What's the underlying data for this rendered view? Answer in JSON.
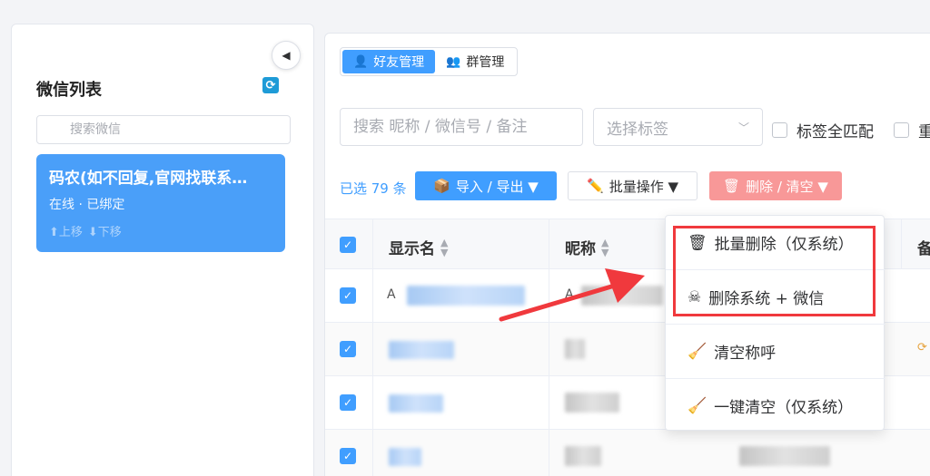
{
  "left_panel": {
    "collapse_icon": "◀",
    "title": "微信列表",
    "refresh_icon": "refresh-icon",
    "search_placeholder": "搜索微信",
    "account": {
      "name": "码农(如不回复,官网找联系…",
      "status": "在线 · 已绑定",
      "move_up": "⬆上移",
      "move_down": "⬇下移"
    }
  },
  "tabs": [
    {
      "label": "好友管理",
      "icon": "👤",
      "active": true
    },
    {
      "label": "群管理",
      "icon": "👥",
      "active": false
    }
  ],
  "filters": {
    "search_placeholder": "搜索 昵称 / 微信号 / 备注",
    "tag_placeholder": "选择标签",
    "tag_match_label": "标签全匹配",
    "second_check_label": "重"
  },
  "toolbar": {
    "selected_count": "已选 79 条",
    "import_export": "导入 / 导出 ▼",
    "import_icon": "📦",
    "batch_ops": "批量操作 ▼",
    "batch_icon": "✏️",
    "delete_clear": "删除 / 清空 ▼",
    "delete_icon": "🗑"
  },
  "table": {
    "headers": {
      "display_name": "显示名",
      "nickname": "昵称",
      "remark": "备"
    },
    "row_prefix_a": "A",
    "row_prefix_a2": "A"
  },
  "dropdown": {
    "items": [
      {
        "icon": "🗑",
        "label": "批量删除（仅系统）"
      },
      {
        "icon": "☠",
        "label": "删除系统 + 微信"
      },
      {
        "icon": "🧹",
        "label": "清空称呼"
      },
      {
        "icon": "🧹",
        "label": "一键清空（仅系统）"
      }
    ]
  },
  "colors": {
    "primary": "#409eff",
    "danger_light": "#f89898",
    "annotation_red": "#f0393d"
  }
}
